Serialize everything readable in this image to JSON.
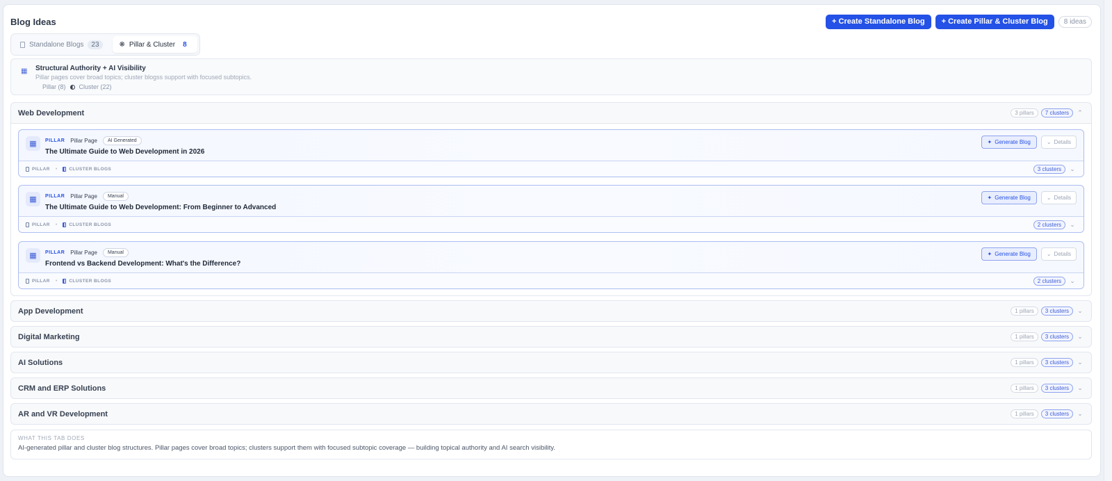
{
  "header": {
    "title": "Blog Ideas",
    "create_standalone": "+ Create Standalone Blog",
    "create_pillar": "+ Create Pillar & Cluster Blog",
    "ideas_count": "8 ideas"
  },
  "tabs": [
    {
      "label": "Standalone Blogs",
      "count": "23"
    },
    {
      "label": "Pillar & Cluster",
      "count": "8"
    }
  ],
  "info": {
    "icon": "grid-icon",
    "title": "Structural Authority + AI Visibility",
    "subtitle": "Pillar pages cover broad topics; cluster blogss support with focused subtopics.",
    "legend_pillar": "Pillar (8)",
    "legend_cluster": "Cluster (22)"
  },
  "categories": [
    {
      "name": "Web Development",
      "pillars": "3 pillars",
      "clusters": "7 clusters",
      "expanded": true,
      "cards": [
        {
          "label": "PILLAR",
          "type": "Pillar Page",
          "badge": "AI Generated",
          "title": "The Ultimate Guide to Web Development in 2026",
          "clusters": "3 clusters"
        },
        {
          "label": "PILLAR",
          "type": "Pillar Page",
          "badge": "Manual",
          "title": "The Ultimate Guide to Web Development: From Beginner to Advanced",
          "clusters": "2 clusters"
        },
        {
          "label": "PILLAR",
          "type": "Pillar Page",
          "badge": "Manual",
          "title": "Frontend vs Backend Development: What's the Difference?",
          "clusters": "2 clusters"
        }
      ]
    },
    {
      "name": "App Development",
      "pillars": "1 pillars",
      "clusters": "3 clusters"
    },
    {
      "name": "Digital Marketing",
      "pillars": "1 pillars",
      "clusters": "3 clusters"
    },
    {
      "name": "AI Solutions",
      "pillars": "1 pillars",
      "clusters": "3 clusters"
    },
    {
      "name": "CRM and ERP Solutions",
      "pillars": "1 pillars",
      "clusters": "3 clusters"
    },
    {
      "name": "AR and VR Development",
      "pillars": "1 pillars",
      "clusters": "3 clusters"
    }
  ],
  "card_labels": {
    "generate": "Generate Blog",
    "details": "Details",
    "foot_pillar": "PILLAR",
    "foot_cluster": "CLUSTER BLOGS"
  },
  "footer_info": {
    "heading": "WHAT THIS TAB DOES",
    "text": "AI-generated pillar and cluster blog structures. Pillar pages cover broad topics; clusters support them with focused subtopic coverage — building topical authority and AI search visibility."
  },
  "colors": {
    "accent": "#2451e6"
  }
}
